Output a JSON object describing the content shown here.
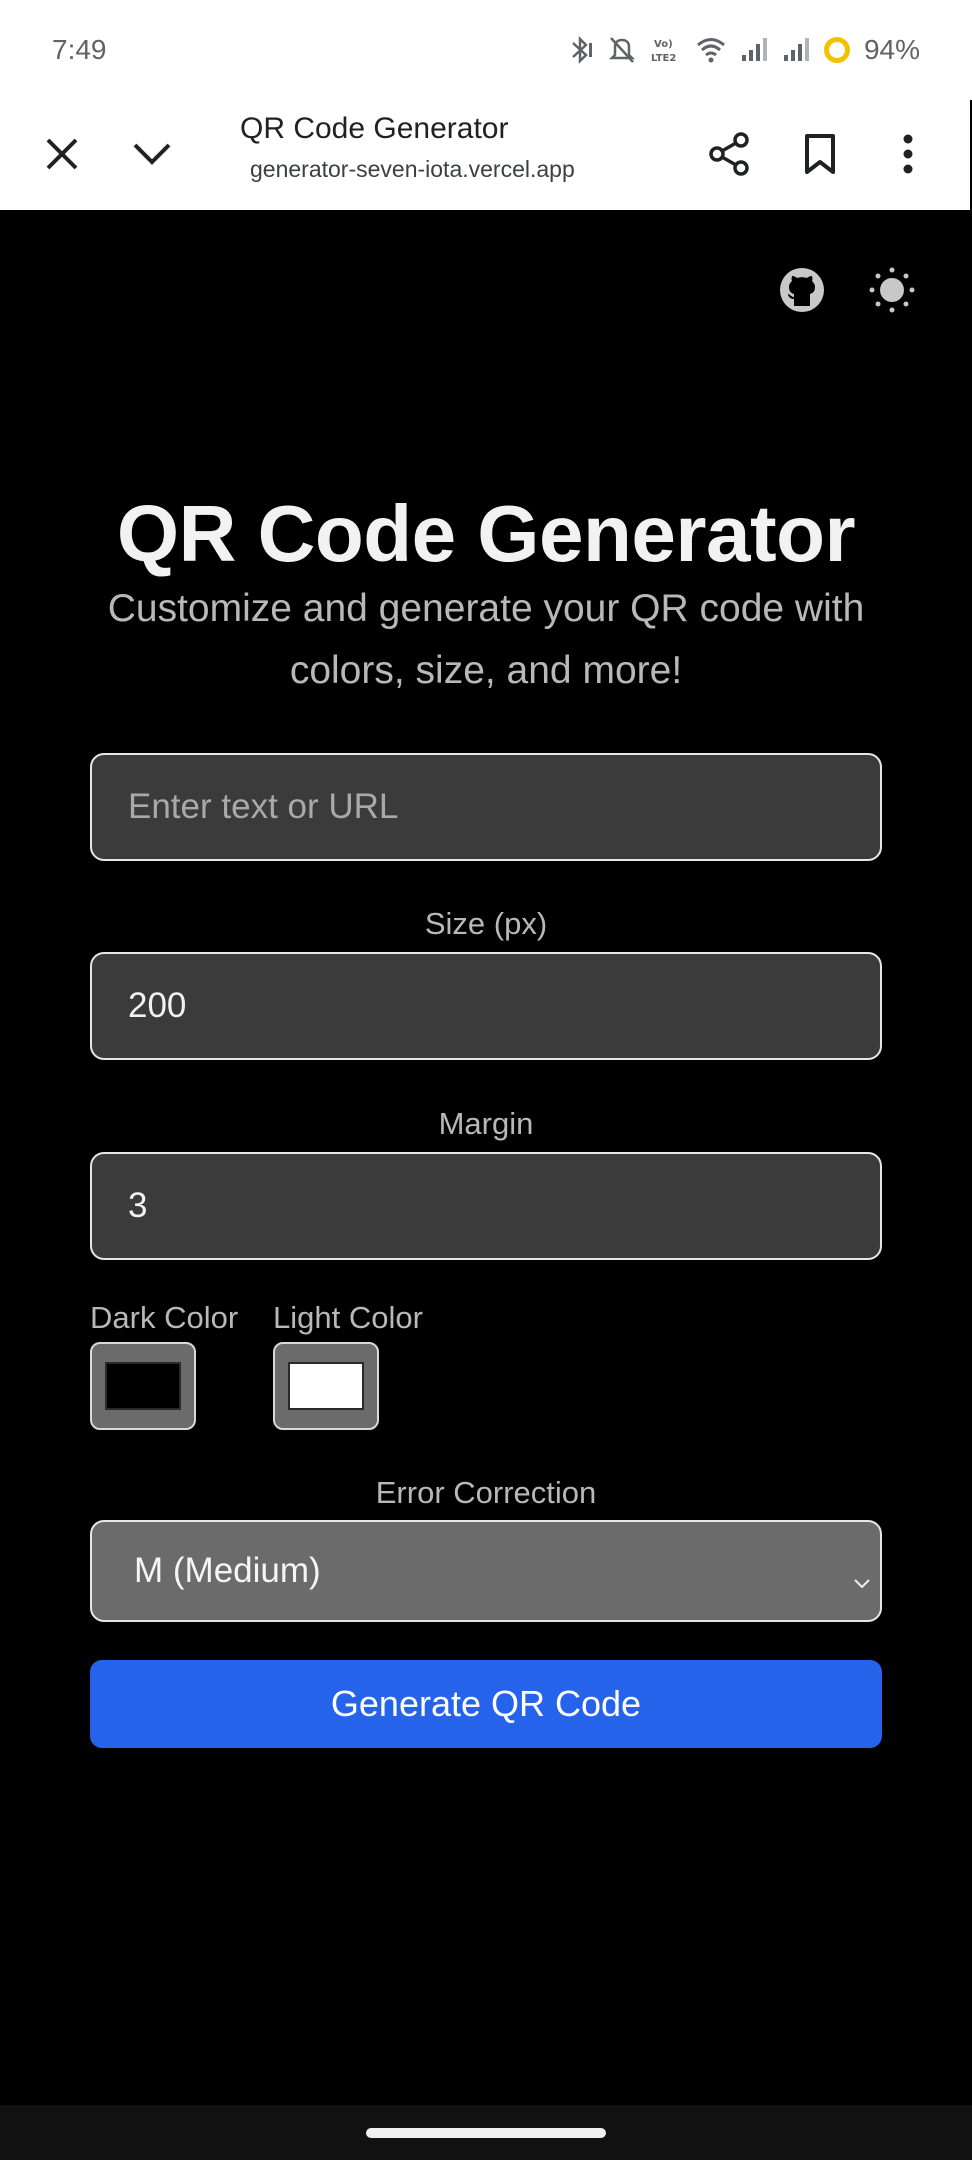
{
  "status_bar": {
    "time": "7:49",
    "battery": "94%",
    "icons": [
      "bluetooth-icon",
      "mute-icon",
      "volte-icon",
      "wifi-icon",
      "signal-icon",
      "signal-icon",
      "battery-icon"
    ],
    "battery_color": "#f2c200"
  },
  "browser": {
    "title": "QR Code Generator",
    "url": "generator-seven-iota.vercel.app",
    "icons": [
      "close-icon",
      "chevron-down-icon",
      "share-icon",
      "bookmark-icon",
      "more-vert-icon"
    ]
  },
  "header_icons": [
    "github-icon",
    "sun-icon"
  ],
  "main": {
    "title": "QR Code Generator",
    "subtitle": "Customize and generate your QR code with colors, size, and more!",
    "text_input": {
      "value": "",
      "placeholder": "Enter text or URL"
    },
    "size": {
      "label": "Size (px)",
      "value": "200"
    },
    "margin": {
      "label": "Margin",
      "value": "3"
    },
    "dark_color": {
      "label": "Dark Color",
      "value": "#000000"
    },
    "light_color": {
      "label": "Light Color",
      "value": "#ffffff"
    },
    "error_correction": {
      "label": "Error Correction",
      "selected": "M (Medium)"
    },
    "generate_label": "Generate QR Code"
  },
  "colors": {
    "accent": "#2563eb",
    "background": "#000000",
    "input_bg": "#3b3b3b",
    "select_bg": "#6b6b6b"
  }
}
